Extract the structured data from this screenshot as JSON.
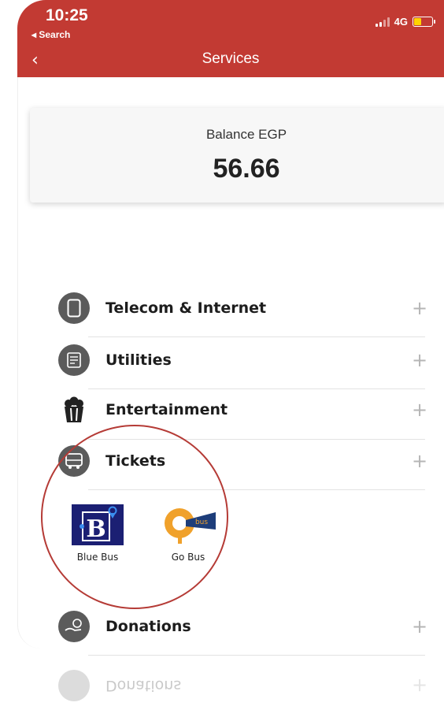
{
  "status_bar": {
    "time": "10:25",
    "back_app": "◂ Search",
    "network": "4G"
  },
  "header": {
    "title": "Services",
    "back_icon": "chevron-left-icon"
  },
  "balance": {
    "label": "Balance EGP",
    "value": "56.66"
  },
  "services": [
    {
      "label": "Telecom & Internet",
      "icon": "phone-icon"
    },
    {
      "label": "Utilities",
      "icon": "bill-icon"
    },
    {
      "label": "Entertainment",
      "icon": "popcorn-icon"
    },
    {
      "label": "Tickets",
      "icon": "bus-icon"
    },
    {
      "label": "Donations",
      "icon": "donation-icon"
    }
  ],
  "tickets": [
    {
      "label": "Blue Bus",
      "icon": "blue-bus-logo"
    },
    {
      "label": "Go Bus",
      "icon": "go-bus-logo"
    }
  ],
  "reflection": {
    "label": "Donations"
  },
  "colors": {
    "header": "#c23a33",
    "highlight": "#b53b36",
    "blue_bus": "#1b1f73",
    "go_bus": "#f0a12b"
  }
}
